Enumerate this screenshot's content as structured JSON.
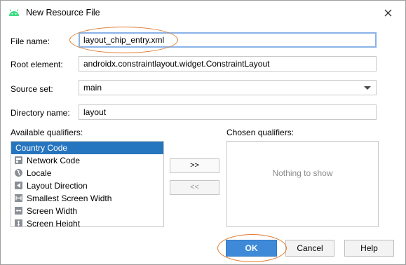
{
  "window": {
    "title": "New Resource File",
    "icon": "android-icon",
    "close_icon": "close-icon"
  },
  "form": {
    "file_name": {
      "label": "File name:",
      "value": "layout_chip_entry.xml"
    },
    "root_element": {
      "label": "Root element:",
      "value": "androidx.constraintlayout.widget.ConstraintLayout"
    },
    "source_set": {
      "label": "Source set:",
      "value": "main"
    },
    "directory_name": {
      "label": "Directory name:",
      "value": "layout"
    }
  },
  "qualifiers": {
    "available_label": "Available qualifiers:",
    "chosen_label": "Chosen qualifiers:",
    "empty_text": "Nothing to show",
    "add_label": ">>",
    "remove_label": "<<",
    "items": [
      {
        "label": "Country Code",
        "icon": "country-code-icon",
        "selected": true
      },
      {
        "label": "Network Code",
        "icon": "network-code-icon"
      },
      {
        "label": "Locale",
        "icon": "globe-icon"
      },
      {
        "label": "Layout Direction",
        "icon": "layout-direction-icon"
      },
      {
        "label": "Smallest Screen Width",
        "icon": "smallest-width-icon"
      },
      {
        "label": "Screen Width",
        "icon": "screen-width-icon"
      },
      {
        "label": "Screen Height",
        "icon": "screen-height-icon"
      }
    ]
  },
  "buttons": {
    "ok": "OK",
    "cancel": "Cancel",
    "help": "Help"
  },
  "colors": {
    "selection": "#2675bf",
    "primary_button": "#3f8ad8",
    "highlight_circle": "#e07a2e",
    "android_green": "#3ddc84"
  }
}
